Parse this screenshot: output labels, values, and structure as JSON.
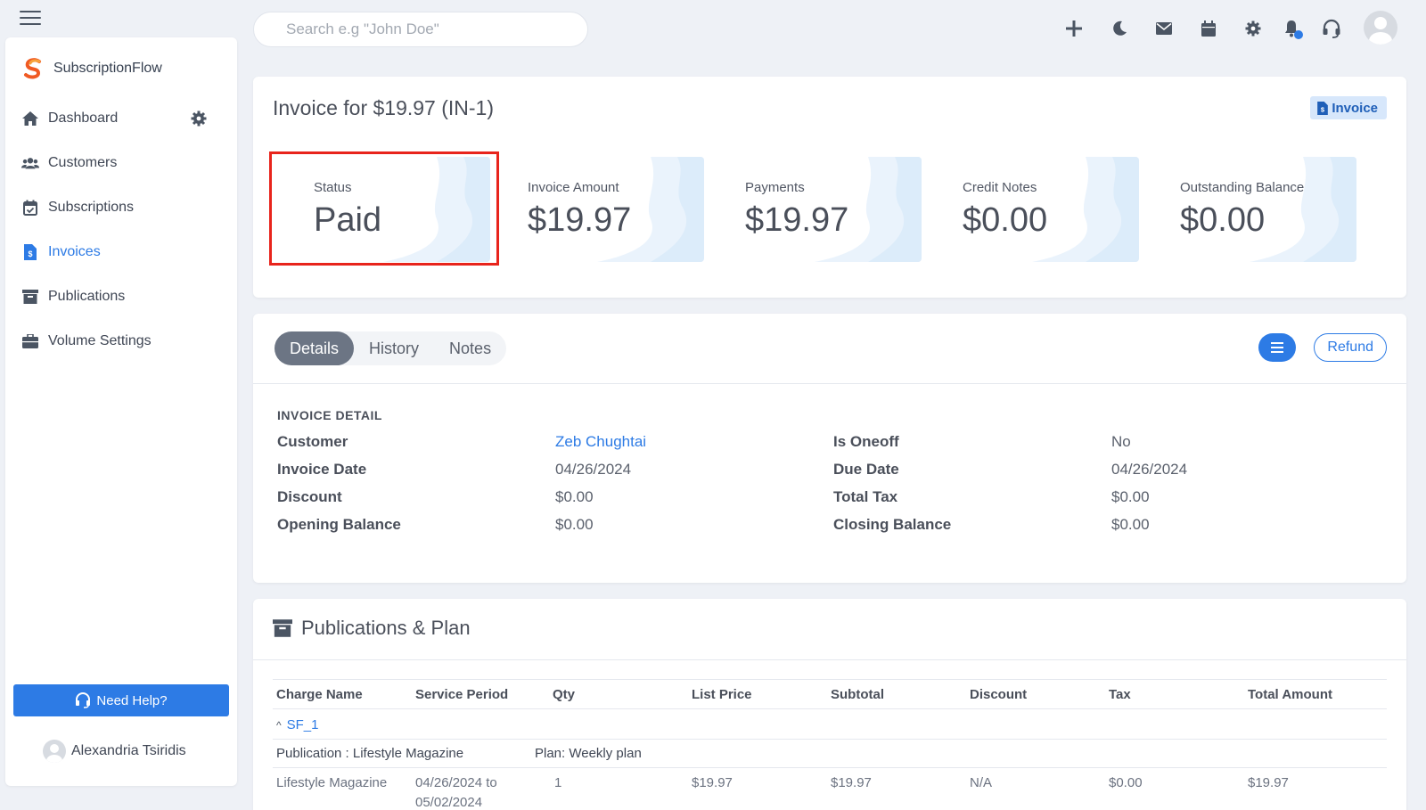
{
  "search": {
    "placeholder": "Search e.g \"John Doe\""
  },
  "brand": {
    "name": "SubscriptionFlow"
  },
  "sidebar": {
    "items": [
      {
        "label": "Dashboard",
        "icon": "home-icon"
      },
      {
        "label": "Customers",
        "icon": "users-icon"
      },
      {
        "label": "Subscriptions",
        "icon": "calendar-check-icon"
      },
      {
        "label": "Invoices",
        "icon": "invoice-icon",
        "active": true
      },
      {
        "label": "Publications",
        "icon": "archive-icon"
      },
      {
        "label": "Volume Settings",
        "icon": "briefcase-icon"
      }
    ],
    "help_label": "Need Help?",
    "user_name": "Alexandria Tsiridis"
  },
  "invoice": {
    "title": "Invoice for $19.97 (IN-1)",
    "badge": "Invoice",
    "stats": [
      {
        "label": "Status",
        "value": "Paid"
      },
      {
        "label": "Invoice Amount",
        "value": "$19.97"
      },
      {
        "label": "Payments",
        "value": "$19.97"
      },
      {
        "label": "Credit Notes",
        "value": "$0.00"
      },
      {
        "label": "Outstanding Balance",
        "value": "$0.00"
      }
    ]
  },
  "details": {
    "tabs": [
      "Details",
      "History",
      "Notes"
    ],
    "refund_label": "Refund",
    "section_title": "INVOICE DETAIL",
    "left": [
      {
        "key": "Customer",
        "value": "Zeb Chughtai"
      },
      {
        "key": "Invoice Date",
        "value": "04/26/2024"
      },
      {
        "key": "Discount",
        "value": "$0.00"
      },
      {
        "key": "Opening Balance",
        "value": "$0.00"
      }
    ],
    "right": [
      {
        "key": "Is Oneoff",
        "value": "No"
      },
      {
        "key": "Due Date",
        "value": "04/26/2024"
      },
      {
        "key": "Total Tax",
        "value": "$0.00"
      },
      {
        "key": "Closing Balance",
        "value": "$0.00"
      }
    ]
  },
  "publications": {
    "title": "Publications & Plan",
    "columns": [
      "Charge Name",
      "Service Period",
      "Qty",
      "List Price",
      "Subtotal",
      "Discount",
      "Tax",
      "Total Amount"
    ],
    "group_link": "SF_1",
    "publication_label": "Publication : Lifestyle Magazine",
    "plan_label": "Plan: Weekly plan",
    "row": {
      "charge_name": "Lifestyle Magazine",
      "period_line1": "04/26/2024 to",
      "period_line2": "05/02/2024",
      "qty": "1",
      "list_price": "$19.97",
      "subtotal": "$19.97",
      "discount": "N/A",
      "tax": "$0.00",
      "total": "$19.97"
    }
  },
  "colors": {
    "accent": "#2d7be5",
    "highlight": "#e8241c"
  }
}
